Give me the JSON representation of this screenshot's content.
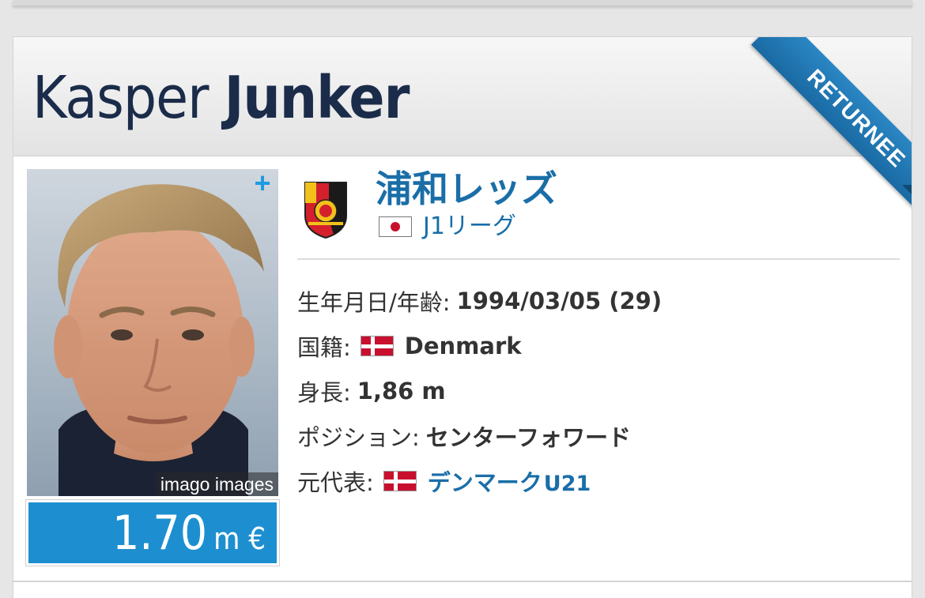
{
  "player": {
    "first_name": "Kasper",
    "last_name": "Junker",
    "badge": "RETURNEE",
    "photo_credit": "imago images",
    "photo_more": "+"
  },
  "market_value": {
    "amount": "1.70",
    "unit": "m €"
  },
  "club": {
    "name": "浦和レッズ",
    "league": "J1リーグ",
    "crest_icon": "urawa-reds-crest"
  },
  "details": {
    "dob_label": "生年月日/年齢:",
    "dob_value": "1994/03/05 (29)",
    "nationality_label": "国籍:",
    "nationality_value": "Denmark",
    "height_label": "身長:",
    "height_value": "1,86 m",
    "position_label": "ポジション:",
    "position_value": "センターフォワード",
    "national_team_label": "元代表:",
    "national_team_value": "デンマーク",
    "national_team_suffix": "U21"
  },
  "colors": {
    "accent": "#1a6ea8",
    "value_bg": "#1d8fd0",
    "ribbon": "#1f79b8",
    "name": "#1b2c4a"
  }
}
